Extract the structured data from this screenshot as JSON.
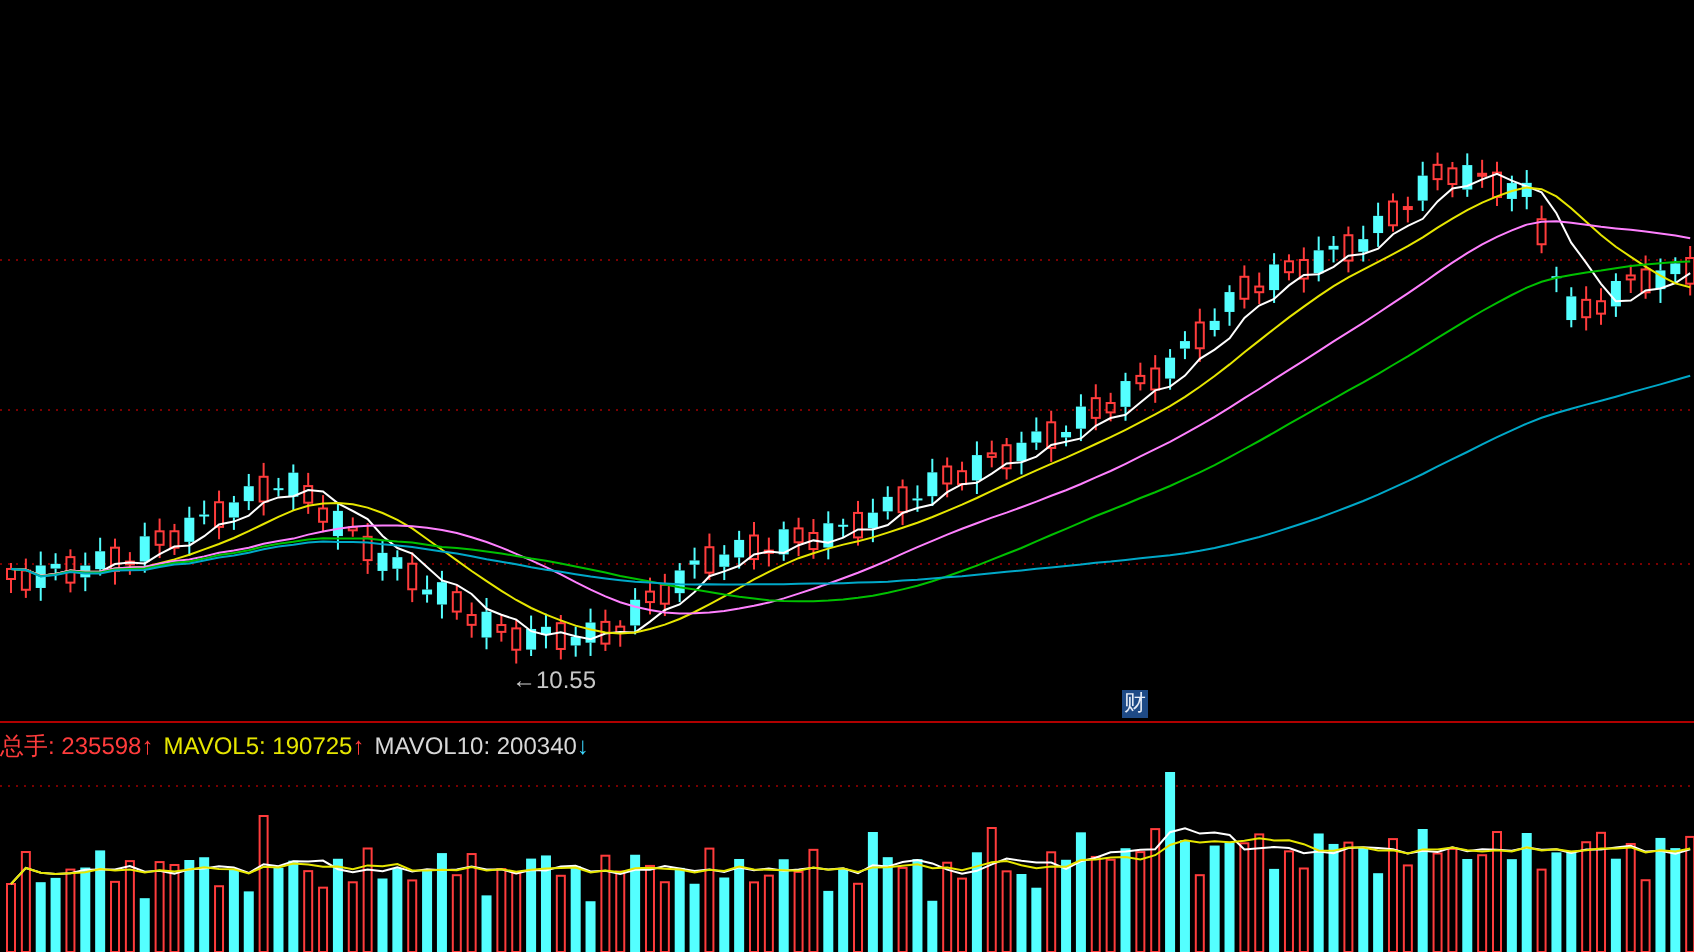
{
  "price_panel": {
    "low_marker": "←10.55",
    "event_badge": "财"
  },
  "volume_panel": {
    "legend": [
      {
        "label": "总手: 235598",
        "arrow": "↑",
        "rising": true,
        "color": "#ff3c3c"
      },
      {
        "label": "MAVOL5: 190725",
        "arrow": "↑",
        "rising": true,
        "color": "#e6e600"
      },
      {
        "label": "MAVOL10: 200340",
        "arrow": "↓",
        "rising": false,
        "color": "#d8d8d8"
      }
    ]
  }
}
